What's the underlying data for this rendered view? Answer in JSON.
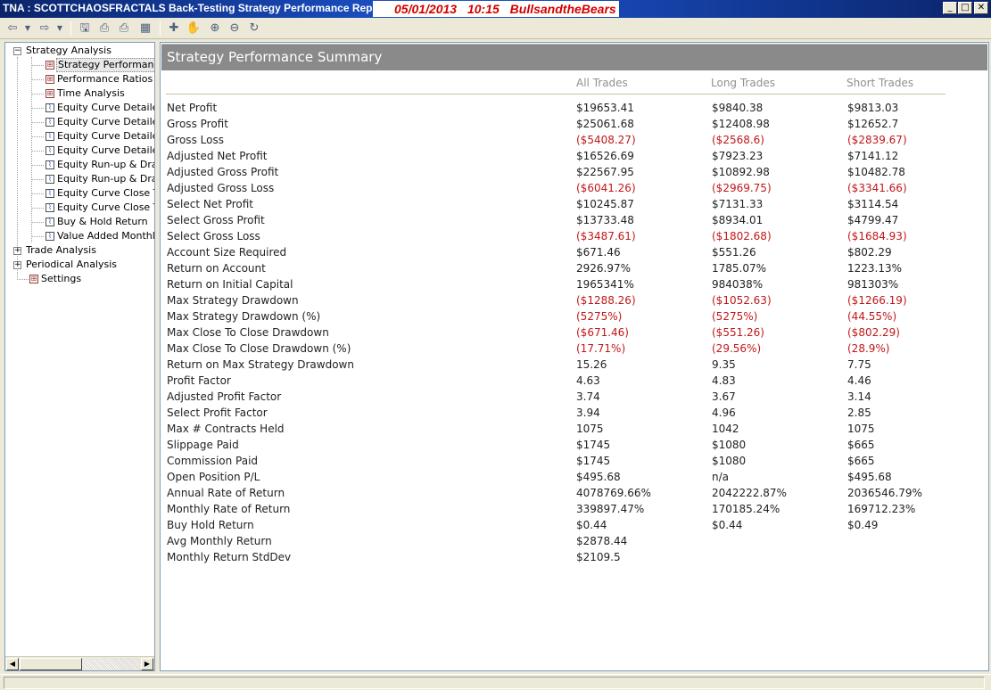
{
  "window": {
    "title": "TNA : SCOTTCHAOSFRACTALS Back-Testing Strategy Performance Report",
    "banner_date": "05/01/2013",
    "banner_time": "10:15",
    "banner_name": "BullsandtheBears"
  },
  "tree": {
    "items": [
      {
        "label": "Strategy Analysis",
        "icon": "collapse-icon"
      },
      {
        "label": "Strategy Performance",
        "icon": "grid-icon"
      },
      {
        "label": "Performance Ratios",
        "icon": "grid-icon"
      },
      {
        "label": "Time Analysis",
        "icon": "grid-icon"
      },
      {
        "label": "Equity Curve Detailed",
        "icon": "chart-icon"
      },
      {
        "label": "Equity Curve Detailed",
        "icon": "chart-icon"
      },
      {
        "label": "Equity Curve Detailed",
        "icon": "chart-icon"
      },
      {
        "label": "Equity Curve Detailed",
        "icon": "chart-icon"
      },
      {
        "label": "Equity Run-up & Drawdown",
        "icon": "chart-icon"
      },
      {
        "label": "Equity Run-up & Drawdown",
        "icon": "chart-icon"
      },
      {
        "label": "Equity Curve Close To Close",
        "icon": "chart-icon"
      },
      {
        "label": "Equity Curve Close To Close",
        "icon": "chart-icon"
      },
      {
        "label": "Buy & Hold Return",
        "icon": "chart-icon"
      },
      {
        "label": "Value Added Monthly Index",
        "icon": "chart-icon"
      },
      {
        "label": "Trade Analysis",
        "icon": "expand-icon"
      },
      {
        "label": "Periodical Analysis",
        "icon": "expand-icon"
      },
      {
        "label": "Settings",
        "icon": "grid-icon"
      }
    ]
  },
  "report": {
    "title": "Strategy Performance Summary",
    "columns": [
      "All Trades",
      "Long Trades",
      "Short Trades"
    ],
    "rows": [
      {
        "label": "Net Profit",
        "all": "$19653.41",
        "long": "$9840.38",
        "short": "$9813.03",
        "neg": false
      },
      {
        "label": "Gross Profit",
        "all": "$25061.68",
        "long": "$12408.98",
        "short": "$12652.7",
        "neg": false
      },
      {
        "label": "Gross Loss",
        "all": "($5408.27)",
        "long": "($2568.6)",
        "short": "($2839.67)",
        "neg": true
      },
      {
        "label": "Adjusted Net Profit",
        "all": "$16526.69",
        "long": "$7923.23",
        "short": "$7141.12",
        "neg": false
      },
      {
        "label": "Adjusted Gross Profit",
        "all": "$22567.95",
        "long": "$10892.98",
        "short": "$10482.78",
        "neg": false
      },
      {
        "label": "Adjusted Gross Loss",
        "all": "($6041.26)",
        "long": "($2969.75)",
        "short": "($3341.66)",
        "neg": true
      },
      {
        "label": "Select Net Profit",
        "all": "$10245.87",
        "long": "$7131.33",
        "short": "$3114.54",
        "neg": false
      },
      {
        "label": "Select Gross Profit",
        "all": "$13733.48",
        "long": "$8934.01",
        "short": "$4799.47",
        "neg": false
      },
      {
        "label": "Select Gross Loss",
        "all": "($3487.61)",
        "long": "($1802.68)",
        "short": "($1684.93)",
        "neg": true
      },
      {
        "label": "Account Size Required",
        "all": "$671.46",
        "long": "$551.26",
        "short": "$802.29",
        "neg": false
      },
      {
        "label": "Return on Account",
        "all": "2926.97%",
        "long": "1785.07%",
        "short": "1223.13%",
        "neg": false
      },
      {
        "label": "Return on Initial Capital",
        "all": "1965341%",
        "long": "984038%",
        "short": "981303%",
        "neg": false
      },
      {
        "label": "Max Strategy Drawdown",
        "all": "($1288.26)",
        "long": "($1052.63)",
        "short": "($1266.19)",
        "neg": true
      },
      {
        "label": "Max Strategy Drawdown (%)",
        "all": "(5275%)",
        "long": "(5275%)",
        "short": "(44.55%)",
        "neg": true
      },
      {
        "label": "Max Close To Close Drawdown",
        "all": "($671.46)",
        "long": "($551.26)",
        "short": "($802.29)",
        "neg": true
      },
      {
        "label": "Max Close To Close Drawdown (%)",
        "all": "(17.71%)",
        "long": "(29.56%)",
        "short": "(28.9%)",
        "neg": true
      },
      {
        "label": "Return on Max Strategy Drawdown",
        "all": "15.26",
        "long": "9.35",
        "short": "7.75",
        "neg": false
      },
      {
        "label": "Profit Factor",
        "all": "4.63",
        "long": "4.83",
        "short": "4.46",
        "neg": false
      },
      {
        "label": "Adjusted Profit Factor",
        "all": "3.74",
        "long": "3.67",
        "short": "3.14",
        "neg": false
      },
      {
        "label": "Select Profit Factor",
        "all": "3.94",
        "long": "4.96",
        "short": "2.85",
        "neg": false
      },
      {
        "label": "Max # Contracts Held",
        "all": "1075",
        "long": "1042",
        "short": "1075",
        "neg": false
      },
      {
        "label": "Slippage Paid",
        "all": "$1745",
        "long": "$1080",
        "short": "$665",
        "neg": false
      },
      {
        "label": "Commission Paid",
        "all": "$1745",
        "long": "$1080",
        "short": "$665",
        "neg": false
      },
      {
        "label": "Open Position P/L",
        "all": "$495.68",
        "long": "n/a",
        "short": "$495.68",
        "neg": false
      },
      {
        "label": "Annual Rate of Return",
        "all": "4078769.66%",
        "long": "2042222.87%",
        "short": "2036546.79%",
        "neg": false
      },
      {
        "label": "Monthly Rate of Return",
        "all": "339897.47%",
        "long": "170185.24%",
        "short": "169712.23%",
        "neg": false
      },
      {
        "label": "Buy  Hold Return",
        "all": "$0.44",
        "long": "$0.44",
        "short": "$0.49",
        "neg": false
      },
      {
        "label": "Avg Monthly Return",
        "all": "$2878.44",
        "long": "",
        "short": "",
        "neg": false
      },
      {
        "label": "Monthly Return StdDev",
        "all": "$2109.5",
        "long": "",
        "short": "",
        "neg": false
      }
    ]
  },
  "colors": {
    "titlebar": "#0a246a",
    "banner_text": "#d40000",
    "negative": "#c01818",
    "header_bar": "#8a8a8a"
  }
}
